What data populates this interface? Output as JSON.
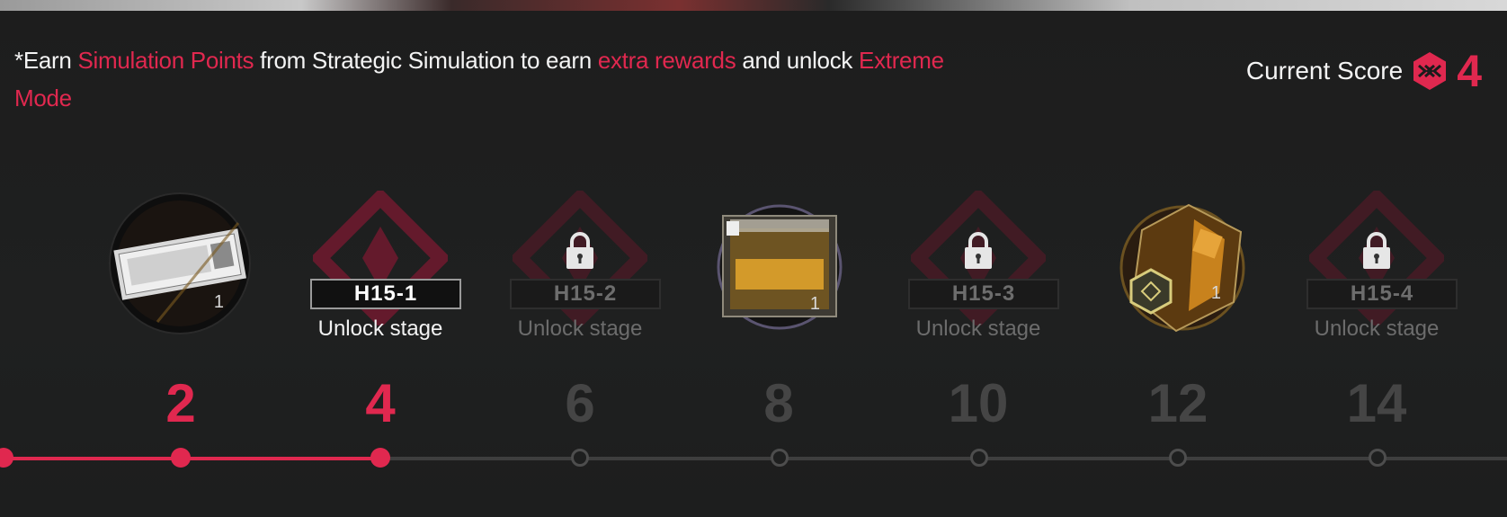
{
  "notice": {
    "p1": "*Earn ",
    "h1": "Simulation Points",
    "p2": " from Strategic Simulation to earn ",
    "h2": "extra rewards",
    "p3": " and unlock ",
    "h3": "Extreme Mode"
  },
  "score": {
    "label": "Current Score",
    "value": "4",
    "icon": "simulation-point-icon"
  },
  "rewards": [
    {
      "icon": "reward-collected-ticket-icon",
      "qty": "1"
    },
    {
      "icon": "reward-collected-box-icon",
      "qty": "1"
    },
    {
      "icon": "hex-badge-reward-icon",
      "qty": "1"
    }
  ],
  "stages": [
    {
      "code": "H15-1",
      "action": "Unlock stage",
      "state": "unlocked"
    },
    {
      "code": "H15-2",
      "action": "Unlock stage",
      "state": "locked"
    },
    {
      "code": "H15-3",
      "action": "Unlock stage",
      "state": "locked"
    },
    {
      "code": "H15-4",
      "action": "Unlock stage",
      "state": "locked"
    }
  ],
  "milestones": [
    "2",
    "4",
    "6",
    "8",
    "10",
    "12",
    "14"
  ],
  "progress": {
    "current": 4,
    "max": 14
  },
  "colors": {
    "accent": "#e0284f",
    "muted": "#454545"
  }
}
